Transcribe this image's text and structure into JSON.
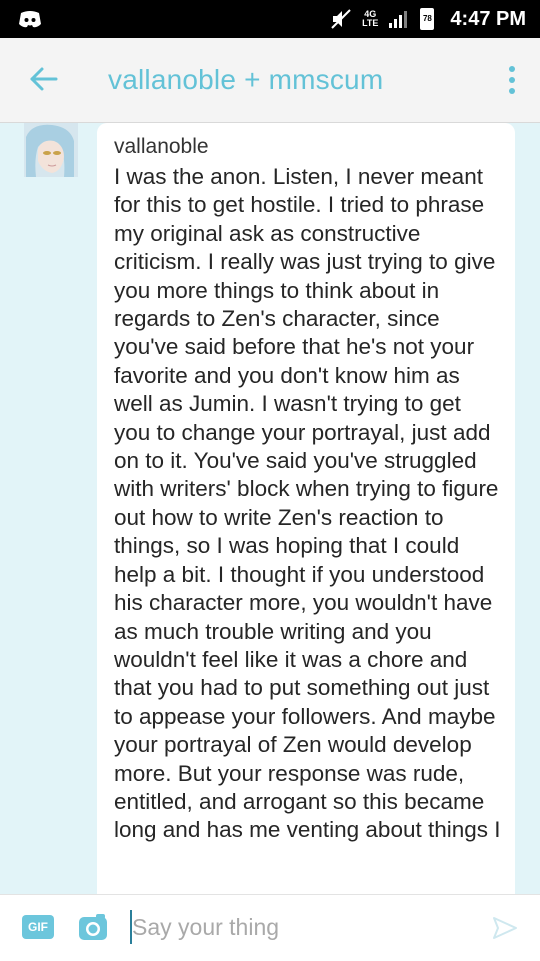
{
  "status_bar": {
    "network": "4G",
    "network_sub": "LTE",
    "battery": "78",
    "time": "4:47 PM"
  },
  "header": {
    "title": "vallanoble + mmscum"
  },
  "message": {
    "sender": "vallanoble",
    "text": "I was the anon. Listen, I never meant for this to get hostile. I tried to phrase my original ask as constructive criticism. I really was just trying to give you more things to think about in regards to Zen's character, since you've said before that he's not your favorite and you don't know him as well as Jumin. I wasn't trying to get you to change your portrayal, just add on to it. You've said you've struggled with writers' block when trying to figure out how to write Zen's reaction to things, so I was hoping that I could help a bit. I thought if you understood his character more, you wouldn't have as much trouble writing and you wouldn't feel like it was a chore and that you had to put something out just to appease your followers. And maybe your portrayal of Zen would develop more. But your response was rude, entitled, and arrogant so this became long and has me venting about things I"
  },
  "composer": {
    "gif_label": "GIF",
    "placeholder": "Say your thing",
    "value": ""
  },
  "icons": {
    "back": "arrow-left-icon",
    "menu": "more-vertical-icon",
    "camera": "camera-icon",
    "send": "send-icon",
    "app": "discord-icon",
    "mute": "volume-mute-icon",
    "signal": "signal-icon",
    "battery": "battery-icon"
  },
  "colors": {
    "accent": "#63c2d7",
    "background": "#e2f4f8",
    "header": "#f4f4f4"
  }
}
